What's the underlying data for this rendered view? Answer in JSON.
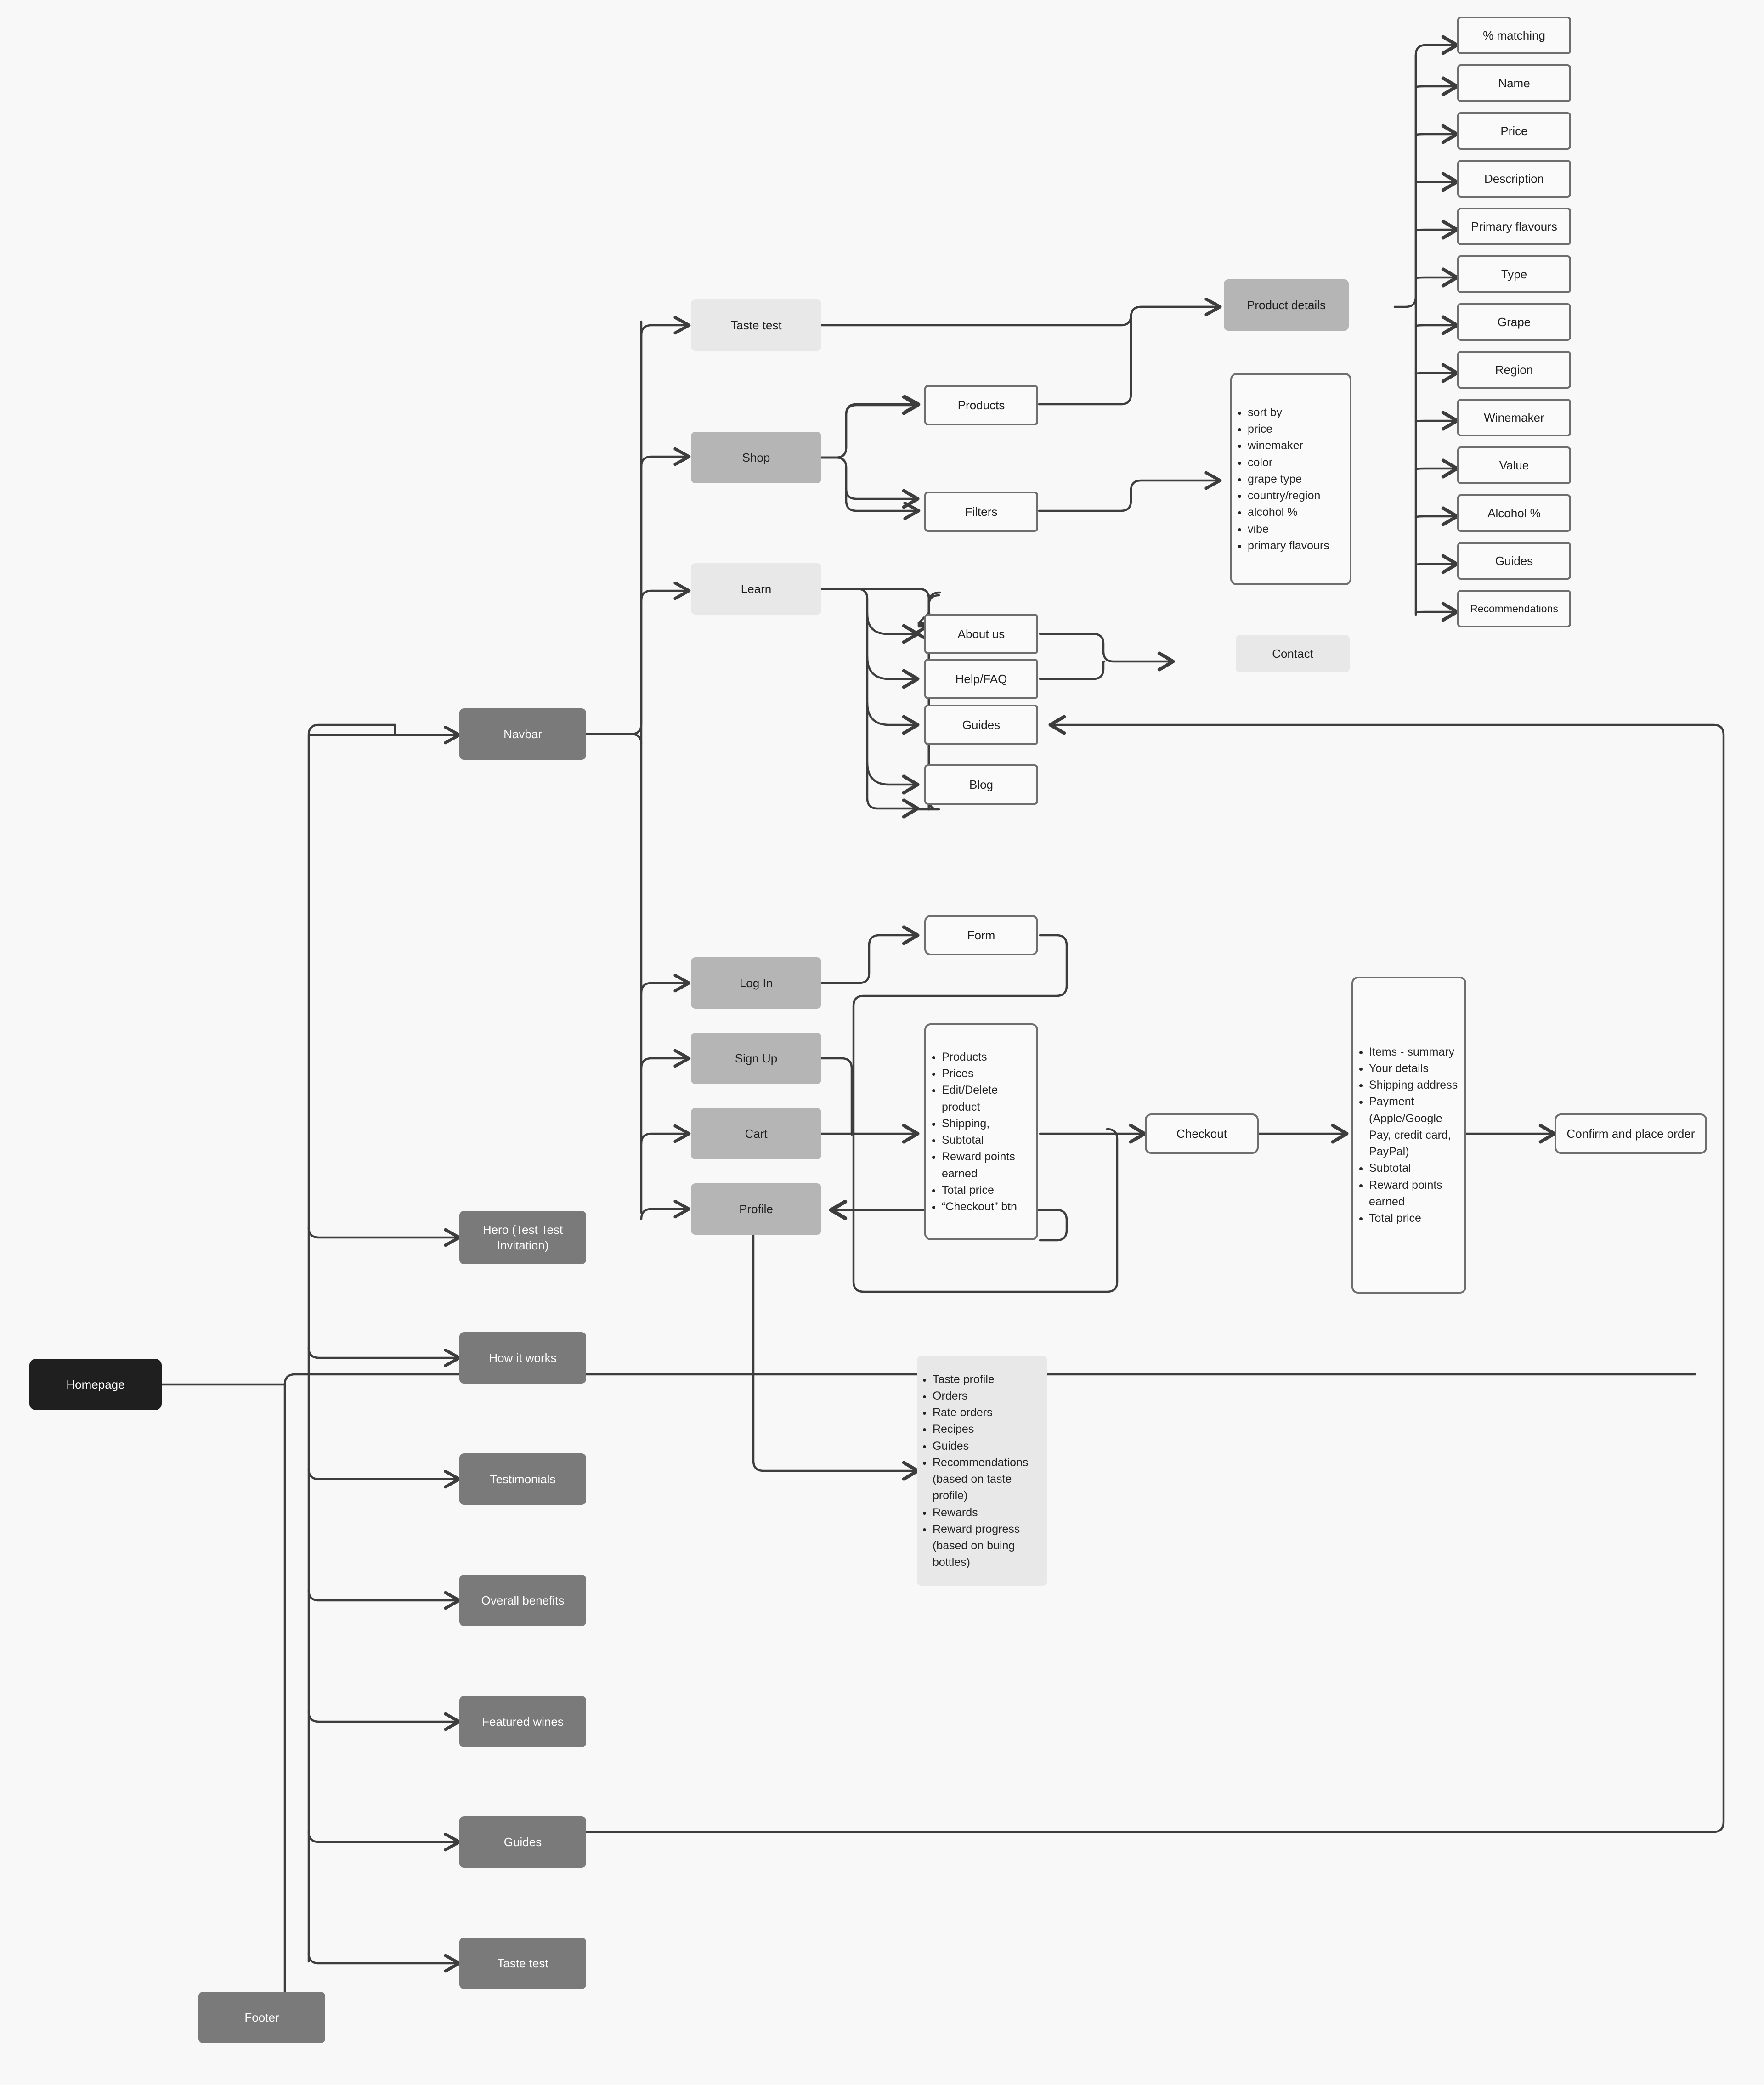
{
  "diagram": {
    "title": "Wine e-commerce sitemap / user flow",
    "background_color": "#f8f8f8",
    "edge_color": "#444444"
  },
  "root": {
    "label": "Homepage"
  },
  "homepage_sections": [
    {
      "label": "Navbar"
    },
    {
      "label": "Hero (Test Test Invitation)"
    },
    {
      "label": "How it works"
    },
    {
      "label": "Testimonials"
    },
    {
      "label": "Overall benefits"
    },
    {
      "label": "Featured wines"
    },
    {
      "label": "Guides"
    },
    {
      "label": "Taste test"
    },
    {
      "label": "Footer"
    }
  ],
  "navbar_items": [
    {
      "label": "Taste test"
    },
    {
      "label": "Shop"
    },
    {
      "label": "Learn"
    },
    {
      "label": "Log In"
    },
    {
      "label": "Sign Up"
    },
    {
      "label": "Cart"
    },
    {
      "label": "Profile"
    }
  ],
  "shop_children": [
    {
      "label": "Products"
    },
    {
      "label": "Filters"
    }
  ],
  "learn_children": [
    {
      "label": "About us"
    },
    {
      "label": "Help/FAQ"
    },
    {
      "label": "Guides"
    },
    {
      "label": "Blog"
    }
  ],
  "contact": {
    "label": "Contact"
  },
  "product_details": {
    "label": "Product details"
  },
  "product_detail_fields": [
    {
      "label": "% matching"
    },
    {
      "label": "Name"
    },
    {
      "label": "Price"
    },
    {
      "label": "Description"
    },
    {
      "label": "Primary flavours"
    },
    {
      "label": "Type"
    },
    {
      "label": "Grape"
    },
    {
      "label": "Region"
    },
    {
      "label": "Winemaker"
    },
    {
      "label": "Value"
    },
    {
      "label": "Alcohol %"
    },
    {
      "label": "Guides"
    },
    {
      "label": "Recommendations"
    }
  ],
  "filters_list": {
    "items": [
      "sort by",
      "price",
      "winemaker",
      "color",
      "grape type",
      "country/region",
      "alcohol %",
      "vibe",
      "primary flavours"
    ]
  },
  "login_form": {
    "label": "Form"
  },
  "cart_list": {
    "items": [
      "Products",
      "Prices",
      "Edit/Delete product",
      "Shipping,",
      "Subtotal",
      "Reward points earned",
      "Total price",
      "“Checkout” btn"
    ]
  },
  "checkout": {
    "label": "Checkout"
  },
  "checkout_list": {
    "items": [
      "Items - summary",
      "Your details",
      "Shipping address",
      "Payment (Apple/Google Pay, credit card, PayPal)",
      "Subtotal",
      "Reward points earned",
      "Total price"
    ]
  },
  "confirm_order": {
    "label": "Confirm and place order"
  },
  "profile_list": {
    "items": [
      "Taste profile",
      "Orders",
      "Rate orders",
      "Recipes",
      "Guides",
      "Recommendations (based on taste profile)",
      "Rewards",
      "Reward progress (based on buing bottles)"
    ]
  }
}
